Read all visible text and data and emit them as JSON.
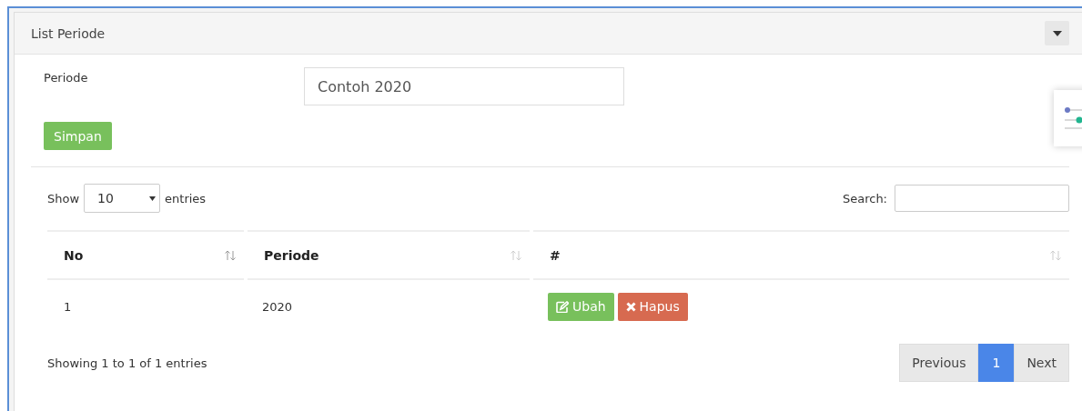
{
  "panel": {
    "title": "List Periode"
  },
  "form": {
    "label": "Periode",
    "placeholder": "Contoh 2020",
    "submit": "Simpan"
  },
  "table_controls": {
    "show_label": "Show",
    "page_size": "10",
    "entries_label": "entries",
    "search_label": "Search:"
  },
  "table": {
    "columns": [
      {
        "label": "No"
      },
      {
        "label": "Periode"
      },
      {
        "label": "#"
      }
    ],
    "rows": [
      {
        "no": "1",
        "periode": "2020",
        "actions": [
          {
            "kind": "edit",
            "label": "Ubah"
          },
          {
            "kind": "delete",
            "label": "Hapus"
          }
        ]
      }
    ]
  },
  "footer": {
    "info": "Showing 1 to 1 of 1 entries",
    "pages": [
      {
        "label": "Previous",
        "selected": false
      },
      {
        "label": "1",
        "selected": true
      },
      {
        "label": "Next",
        "selected": false
      }
    ]
  }
}
